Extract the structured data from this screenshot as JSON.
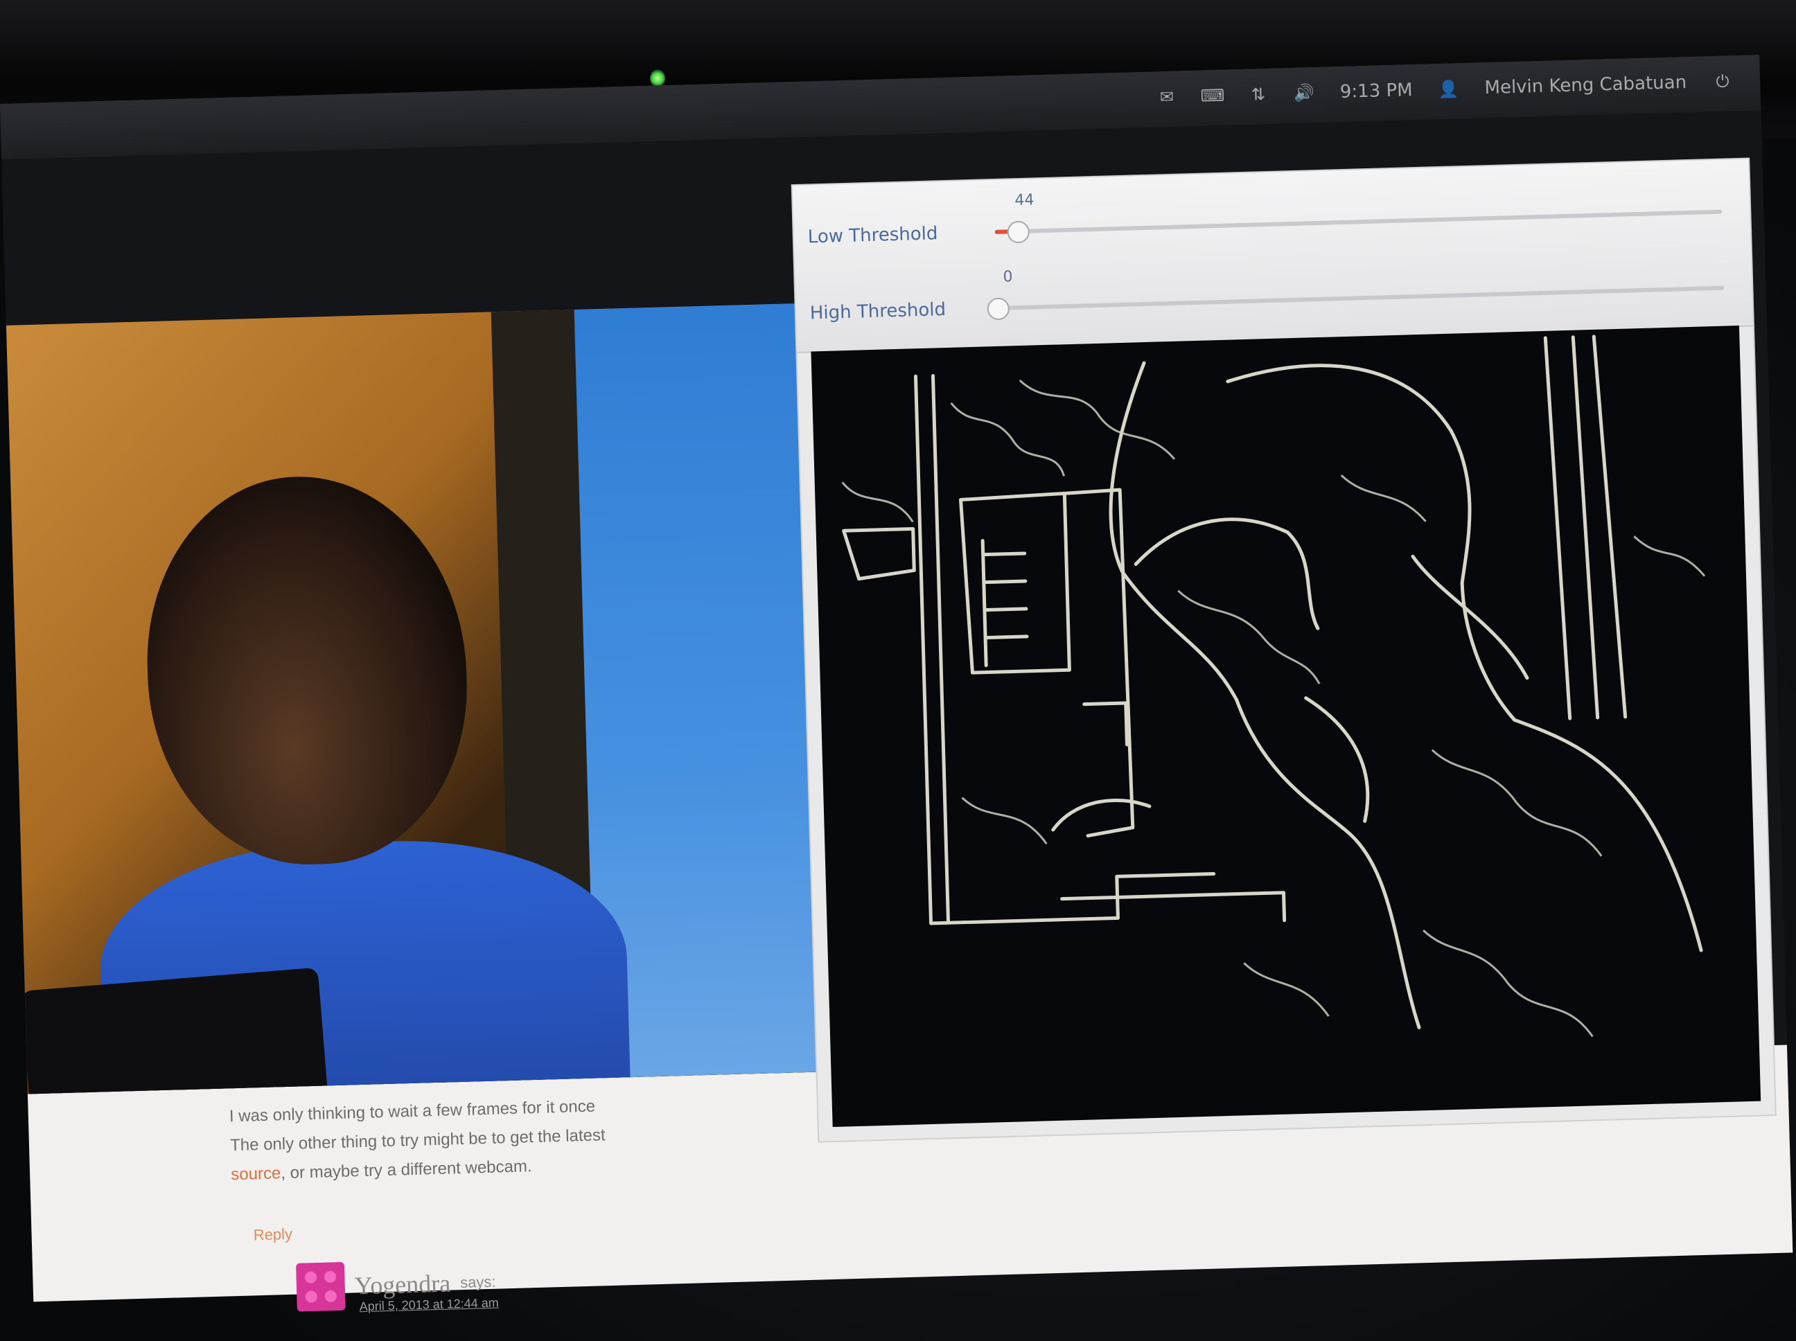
{
  "system_panel": {
    "clock": "9:13 PM",
    "user": "Melvin Keng Cabatuan",
    "icons": [
      "mail-icon",
      "keyboard-icon",
      "network-icon",
      "volume-icon",
      "user-icon",
      "power-icon"
    ]
  },
  "edge_window": {
    "trackbars": [
      {
        "label": "Low Threshold",
        "value": "44",
        "fraction": 0.03
      },
      {
        "label": "High Threshold",
        "value": "0",
        "fraction": 0.0
      }
    ]
  },
  "browser_page": {
    "comment_lines": [
      "I was only thinking to wait a few frames  for it  once",
      "The only other thing to try might be to get the latest",
      "or maybe try a different webcam."
    ],
    "comment_link": "source",
    "reply_label": "Reply",
    "commenter": {
      "name": "Yogendra",
      "says": "says:",
      "date": "April 5, 2013 at 12:44 am"
    }
  },
  "colors": {
    "trackbar_fill": "#e2503a",
    "link": "#e06d3b",
    "avatar": "#d8359b",
    "edge_lines": "#d8d6c8"
  }
}
